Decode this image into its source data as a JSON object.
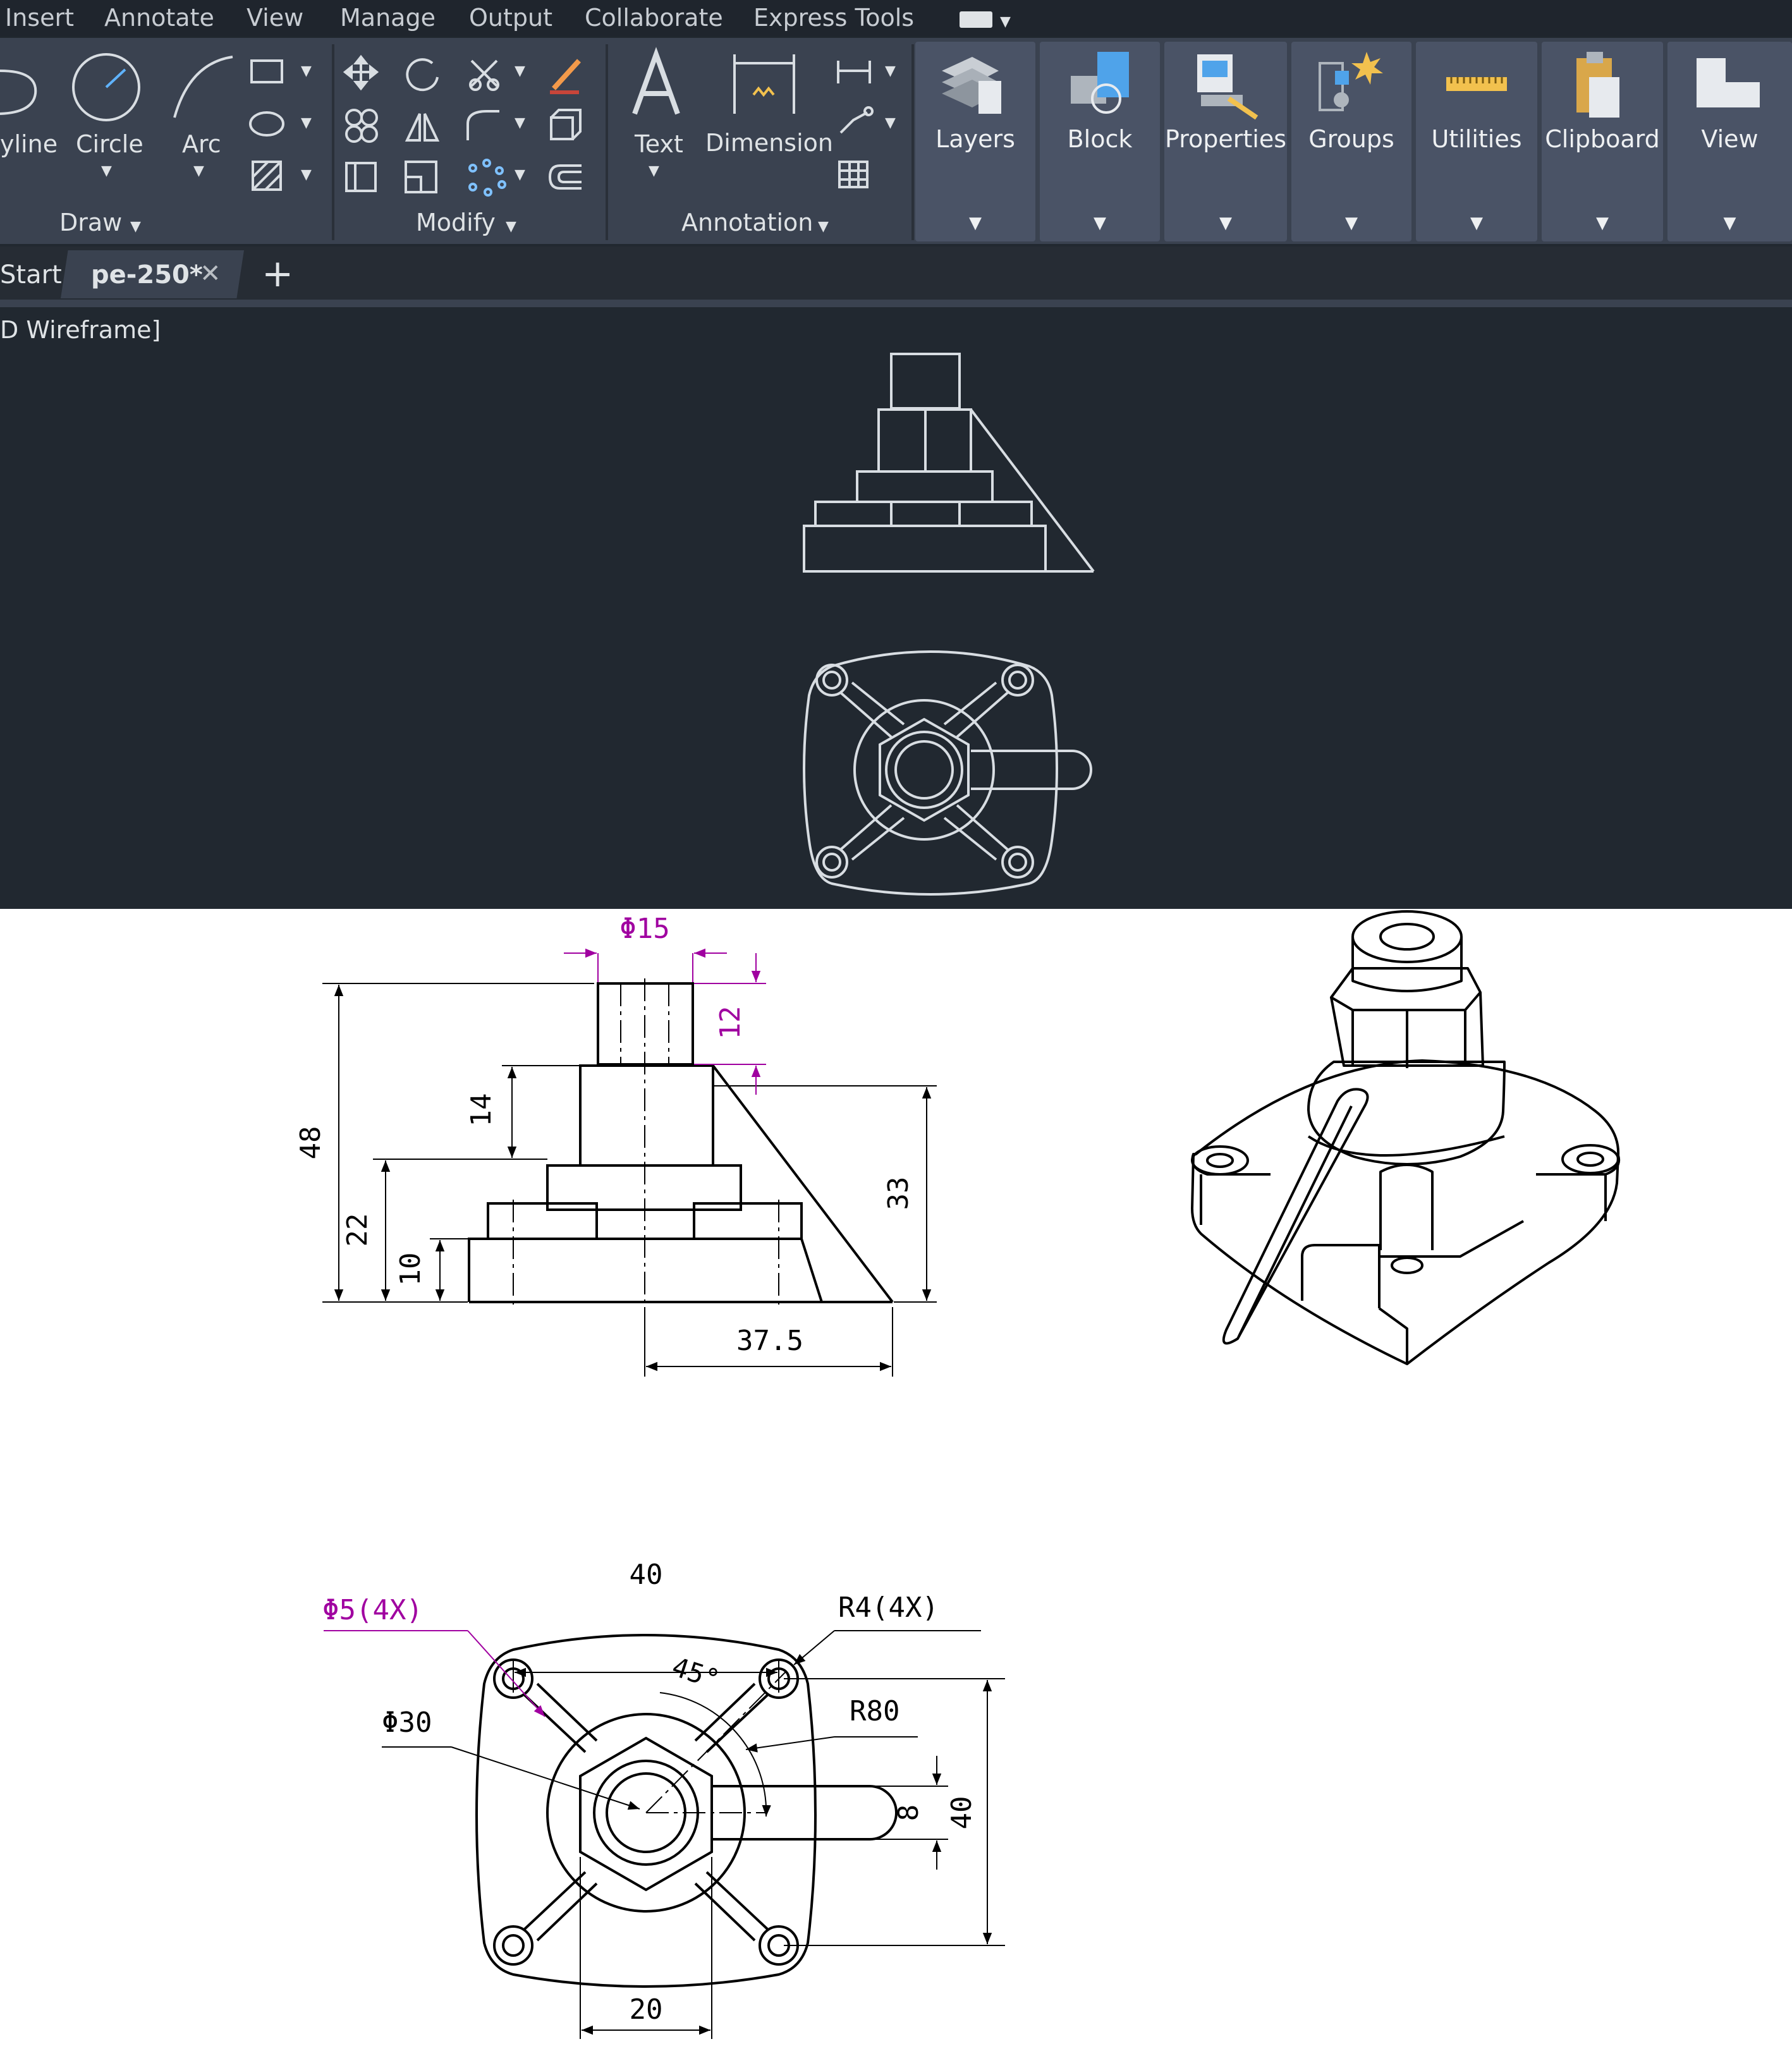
{
  "menu": [
    "Insert",
    "Annotate",
    "View",
    "Manage",
    "Output",
    "Collaborate",
    "Express Tools"
  ],
  "ribbon": {
    "draw_tools": [
      "yline",
      "Circle",
      "Arc"
    ],
    "panels": [
      "Draw",
      "Modify",
      "Annotation"
    ],
    "annotation_tools": [
      "Text",
      "Dimension"
    ],
    "big_buttons": [
      "Layers",
      "Block",
      "Properties",
      "Groups",
      "Utilities",
      "Clipboard",
      "View"
    ]
  },
  "tabs": {
    "start": "Start",
    "drawing": "pe-250*",
    "close_glyph": "✕",
    "add_glyph": "+"
  },
  "viewport_label": "D Wireframe]",
  "drawing": {
    "front_view": {
      "phi15": "Φ15",
      "d12": "12",
      "d14": "14",
      "d48": "48",
      "d22": "22",
      "d10": "10",
      "d33": "33",
      "d37_5": "37.5"
    },
    "top_view": {
      "d40_top": "40",
      "phi5": "Φ5(4X)",
      "r4": "R4(4X)",
      "angle": "45°",
      "r80": "R80",
      "phi30": "Φ30",
      "d8": "8",
      "d40_side": "40",
      "d20": "20"
    }
  },
  "colors": {
    "ribbon": "#3a4250",
    "canvas": "#212830",
    "dimension_accent": "#a000a0"
  }
}
